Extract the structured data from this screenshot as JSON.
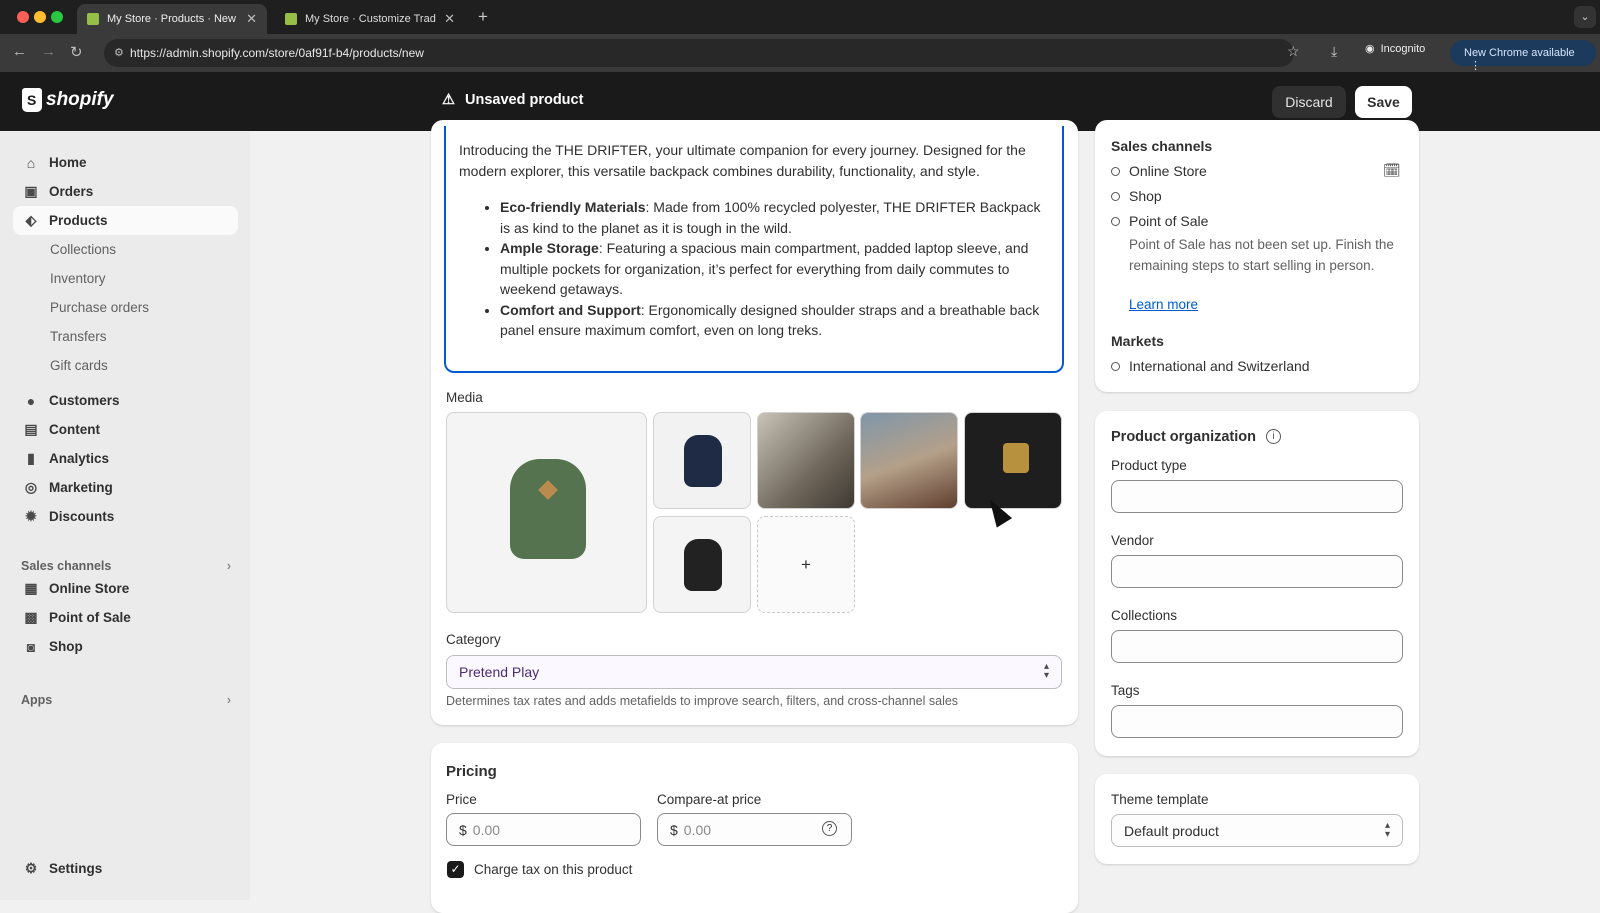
{
  "browser": {
    "tabs": [
      {
        "label": "My Store · Products · New · S"
      },
      {
        "label": "My Store · Customize Trade"
      }
    ],
    "url": "https://admin.shopify.com/store/0af91f-b4/products/new",
    "incognito": "Incognito",
    "new_chrome": "New Chrome available"
  },
  "header": {
    "logo": "shopify",
    "title": "Unsaved product",
    "discard": "Discard",
    "save": "Save"
  },
  "sidebar": {
    "items": [
      "Home",
      "Orders",
      "Products"
    ],
    "sub_items": [
      "Collections",
      "Inventory",
      "Purchase orders",
      "Transfers",
      "Gift cards"
    ],
    "items2": [
      "Customers",
      "Content",
      "Analytics",
      "Marketing",
      "Discounts"
    ],
    "sales_channels_label": "Sales channels",
    "channels": [
      "Online Store",
      "Point of Sale",
      "Shop"
    ],
    "apps_label": "Apps",
    "settings": "Settings"
  },
  "description": {
    "intro": "Introducing the THE DRIFTER, your ultimate companion for every journey. Designed for the modern explorer, this versatile backpack combines durability, functionality, and style.",
    "bullets": [
      {
        "bold": "Eco-friendly Materials",
        "text": ": Made from 100% recycled polyester, THE DRIFTER Backpack is as kind to the planet as it is tough in the wild."
      },
      {
        "bold": "Ample Storage",
        "text": ": Featuring a spacious main compartment, padded laptop sleeve, and multiple pockets for organization, it’s perfect for everything from daily commutes to weekend getaways."
      },
      {
        "bold": "Comfort and Support",
        "text": ": Ergonomically designed shoulder straps and a breathable back panel ensure maximum comfort, even on long treks."
      }
    ]
  },
  "media": {
    "label": "Media",
    "add": "+"
  },
  "category": {
    "label": "Category",
    "value": "Pretend Play",
    "help": "Determines tax rates and adds metafields to improve search, filters, and cross-channel sales"
  },
  "pricing": {
    "title": "Pricing",
    "price_label": "Price",
    "price_value": "0.00",
    "compare_label": "Compare-at price",
    "compare_value": "0.00",
    "currency": "$",
    "charge_tax": "Charge tax on this product"
  },
  "sales_channels": {
    "title": "Sales channels",
    "channels": [
      "Online Store",
      "Shop",
      "Point of Sale"
    ],
    "pos_note": "Point of Sale has not been set up. Finish the remaining steps to start selling in person.",
    "learn_more": "Learn more",
    "markets_title": "Markets",
    "market": "International and Switzerland"
  },
  "organization": {
    "title": "Product organization",
    "product_type": "Product type",
    "vendor": "Vendor",
    "collections": "Collections",
    "tags": "Tags"
  },
  "theme": {
    "label": "Theme template",
    "value": "Default product"
  },
  "colors": {
    "accent": "#005bd3",
    "topbar": "#1a1a1a",
    "shopify_green": "#95bf47"
  }
}
